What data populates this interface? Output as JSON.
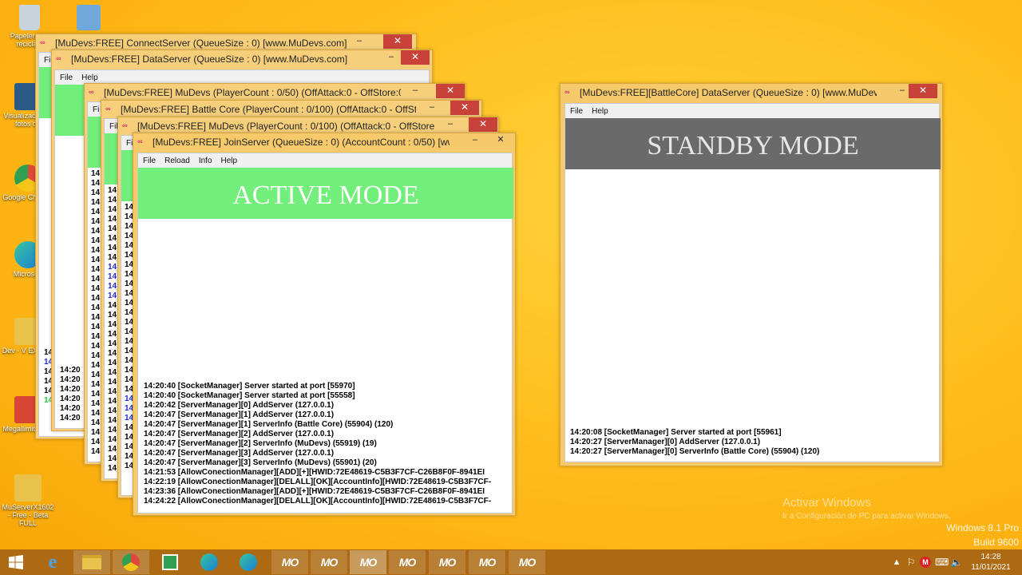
{
  "desktop": {
    "icons": [
      {
        "label": "Papelera de reciclaje",
        "color": "#c9d3dc"
      },
      {
        "label": "",
        "color": "#6fa8d9"
      },
      {
        "label": "Visualizador de fotos de",
        "color": "#2c5a87"
      },
      {
        "label": "Google Chrome",
        "color": "#e0483b"
      },
      {
        "label": "Microsoft",
        "color": "#1b7fd4"
      },
      {
        "label": "Dev - V EX1602",
        "color": "#e8c24a"
      },
      {
        "label": "Megallimitada...",
        "color": "#d94534"
      },
      {
        "label": "MuServerX1602 - Free - Beta FULL",
        "color": "#e8c24a"
      }
    ]
  },
  "windows": {
    "connect": {
      "title": "[MuDevs:FREE] ConnectServer (QueueSize : 0) [www.MuDevs.com]",
      "menu": [
        "File"
      ],
      "log": [
        "14:20",
        "14:20",
        "14:20",
        "14:20",
        "14:20",
        "14:20"
      ]
    },
    "data": {
      "title": "[MuDevs:FREE] DataServer (QueueSize : 0) [www.MuDevs.com]",
      "menu": [
        "File",
        "Help"
      ],
      "log": [
        "14:20",
        "14:20",
        "14:20",
        "14:20",
        "14:20",
        "14:20"
      ]
    },
    "game1": {
      "title": "[MuDevs:FREE] MuDevs (PlayerCount : 0/50) (OffAttack:0 - OffStore:0...",
      "menu": [
        "Fi"
      ]
    },
    "battle": {
      "title": "[MuDevs:FREE] Battle Core (PlayerCount : 0/100) (OffAttack:0 - OffSt...",
      "menu": [
        "Fil"
      ]
    },
    "game2": {
      "title": "[MuDevs:FREE] MuDevs (PlayerCount : 0/100) (OffAttack:0 - OffStore:...",
      "menu": [
        "Fil"
      ]
    },
    "join": {
      "title": "[MuDevs:FREE] JoinServer (QueueSize : 0) (AccountCount : 0/50) [ww...",
      "menu": [
        "File",
        "Reload",
        "Info",
        "Help"
      ],
      "mode": "ACTIVE MODE",
      "log": [
        "14:20:40 [SocketManager] Server started at port [55970]",
        "14:20:40 [SocketManager] Server started at port [55558]",
        "14:20:42 [ServerManager][0] AddServer (127.0.0.1)",
        "14:20:47 [ServerManager][1] AddServer (127.0.0.1)",
        "14:20:47 [ServerManager][1] ServerInfo (Battle Core) (55904) (120)",
        "14:20:47 [ServerManager][2] AddServer (127.0.0.1)",
        "14:20:47 [ServerManager][2] ServerInfo (MuDevs) (55919) (19)",
        "14:20:47 [ServerManager][3] AddServer (127.0.0.1)",
        "14:20:47 [ServerManager][3] ServerInfo (MuDevs) (55901) (20)",
        "14:21:53 [AllowConectionManager][ADD][+][HWID:72E48619-C5B3F7CF-C26B8F0F-8941EI",
        "14:22:19 [AllowConectionManager][DELALL][OK][AccountInfo][HWID:72E48619-C5B3F7CF-",
        "14:23:36 [AllowConectionManager][ADD][+][HWID:72E48619-C5B3F7CF-C26B8F0F-8941EI",
        "14:24:22 [AllowConectionManager][DELALL][OK][AccountInfo][HWID:72E48619-C5B3F7CF-"
      ]
    },
    "battle_data": {
      "title": "[MuDevs:FREE][BattleCore] DataServer (QueueSize : 0) [www.MuDev...",
      "menu": [
        "File",
        "Help"
      ],
      "mode": "STANDBY MODE",
      "log": [
        "14:20:08 [SocketManager] Server started at port [55961]",
        "14:20:27 [ServerManager][0] AddServer (127.0.0.1)",
        "14:20:27 [ServerManager][0] ServerInfo (Battle Core) (55904) (120)"
      ]
    }
  },
  "watermark": {
    "line1": "Activar Windows",
    "line2": "Ir a Configuración de PC para activar Windows.",
    "edition": "Windows 8.1 Pro",
    "build": "Build 9600"
  },
  "taskbar": {
    "apps": [
      "start",
      "ie",
      "explorer",
      "chrome",
      "store",
      "edge",
      "edge2"
    ],
    "mu_label": "MO",
    "mu_count": 7,
    "clock_time": "14:28",
    "clock_date": "11/01/2021"
  },
  "colors": {
    "active_band": "#72ee7a",
    "standby_band": "#6a6a6a",
    "taskbar": "#ad6a12"
  }
}
